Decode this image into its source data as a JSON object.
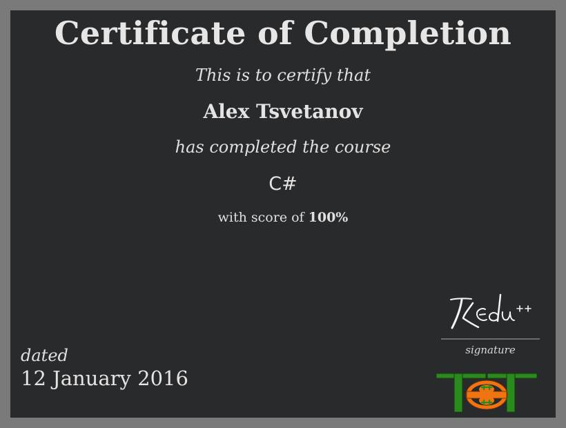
{
  "certificate": {
    "title": "Certificate of Completion",
    "intro": "This is to certify that",
    "recipient_name": "Alex Tsvetanov",
    "completion_text": "has completed the course",
    "course_name": "C#",
    "score_prefix": "with score of",
    "score_value": "100%",
    "dated_label": "dated",
    "date": "12 January 2016",
    "signature_label": "signature",
    "signature_image": "Edu++",
    "logo_icon": "tot-logo-icon"
  },
  "colors": {
    "page_border": "#7a7a7a",
    "certificate_background": "#292a2c",
    "text": "#e2e2e2",
    "logo_green": "#2a8a1e",
    "logo_orange": "#f07410"
  }
}
